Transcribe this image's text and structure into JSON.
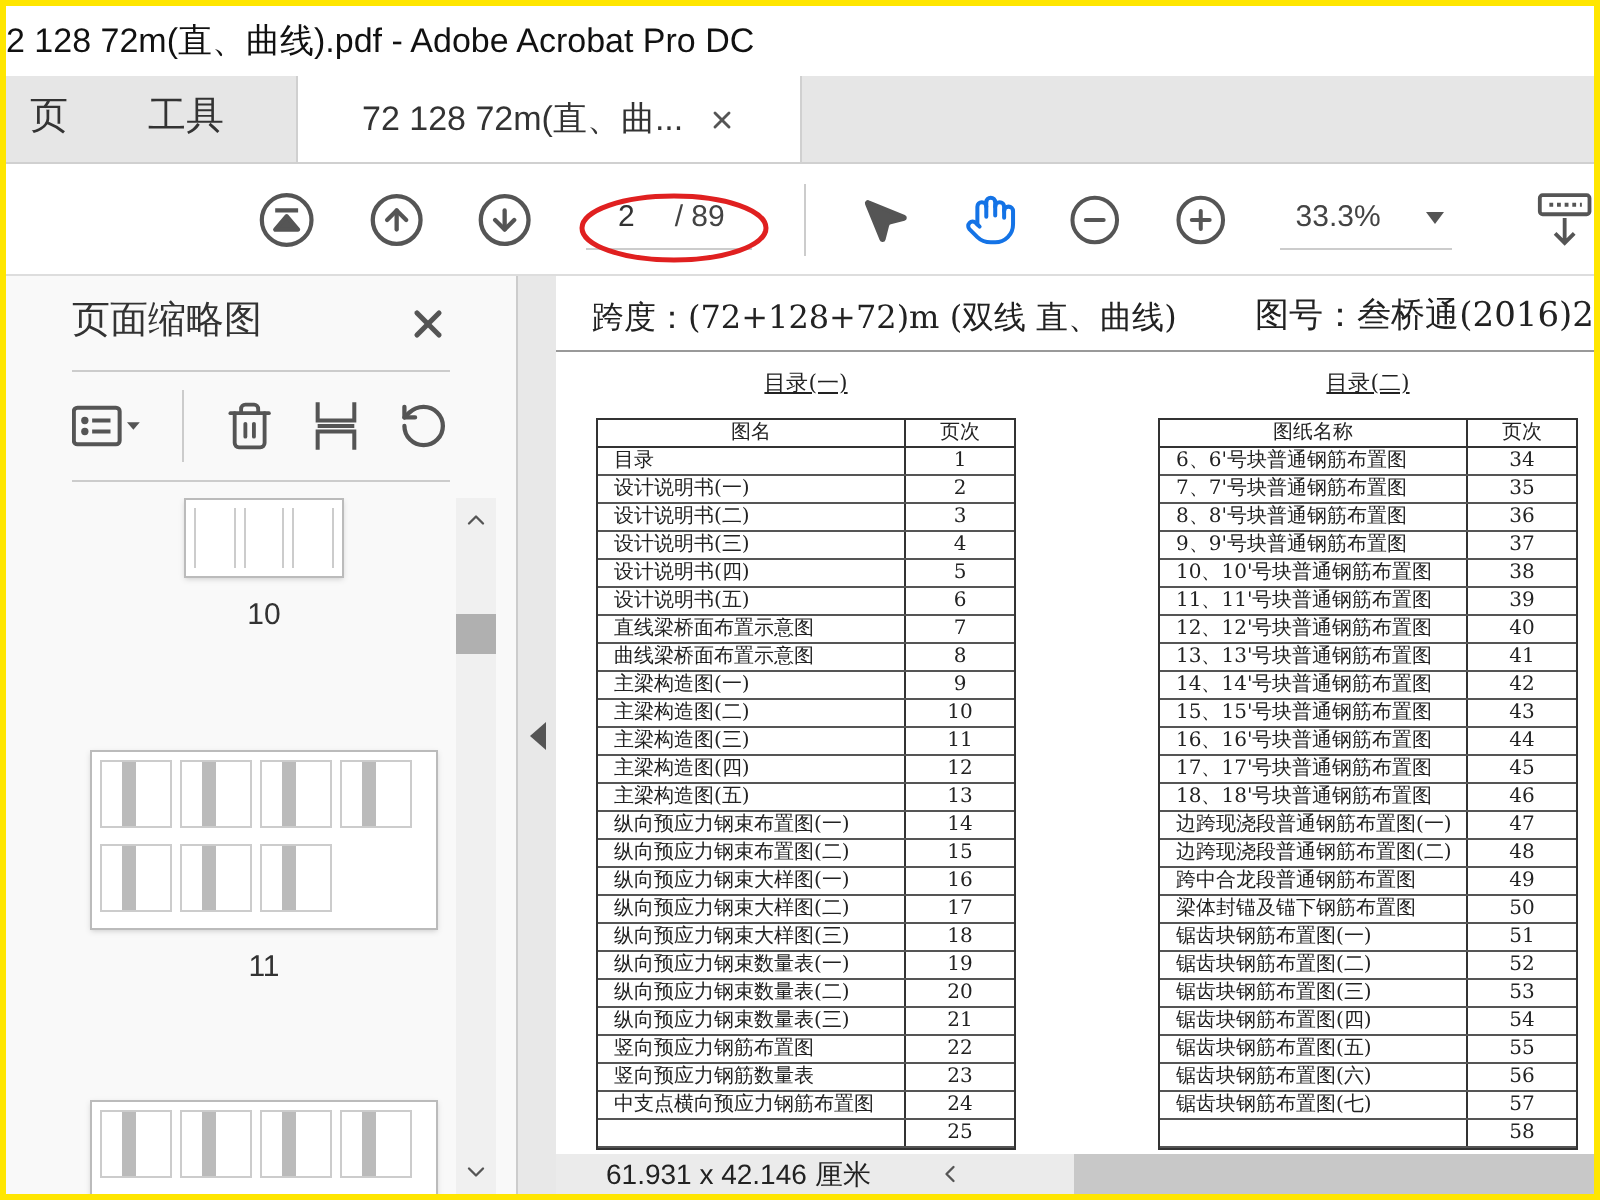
{
  "window": {
    "title": "2 128 72m(直、曲线).pdf - Adobe Acrobat Pro DC"
  },
  "tabs": [
    {
      "label": "页",
      "kind": "nav",
      "selected": false
    },
    {
      "label": "工具",
      "kind": "nav",
      "selected": false
    },
    {
      "label": "72 128 72m(直、曲...",
      "kind": "document",
      "selected": true
    }
  ],
  "toolbar": {
    "page_current": "2",
    "page_total": "/ 89",
    "zoom": "33.3%",
    "tools": [
      {
        "kind": "select",
        "selected": false
      },
      {
        "kind": "hand",
        "selected": true
      }
    ]
  },
  "sidebar": {
    "title": "页面缩略图",
    "thumbnails": [
      {
        "label": "10",
        "kind": "portrait"
      },
      {
        "label": "11",
        "kind": "landscape"
      },
      {
        "kind": "landscape"
      }
    ]
  },
  "document": {
    "header_left": "跨度：(72+128+72)m (双线 直、曲线)",
    "header_right": "图号：叁桥通(2016)2",
    "tables": [
      {
        "title": "目录(一)",
        "columns": [
          "图名",
          "页次"
        ],
        "rows": [
          {
            "name": "目录",
            "page": "1"
          },
          {
            "name": "设计说明书(一)",
            "page": "2"
          },
          {
            "name": "设计说明书(二)",
            "page": "3"
          },
          {
            "name": "设计说明书(三)",
            "page": "4"
          },
          {
            "name": "设计说明书(四)",
            "page": "5"
          },
          {
            "name": "设计说明书(五)",
            "page": "6"
          },
          {
            "name": "直线梁桥面布置示意图",
            "page": "7"
          },
          {
            "name": "曲线梁桥面布置示意图",
            "page": "8"
          },
          {
            "name": "主梁构造图(一)",
            "page": "9"
          },
          {
            "name": "主梁构造图(二)",
            "page": "10"
          },
          {
            "name": "主梁构造图(三)",
            "page": "11"
          },
          {
            "name": "主梁构造图(四)",
            "page": "12"
          },
          {
            "name": "主梁构造图(五)",
            "page": "13"
          },
          {
            "name": "纵向预应力钢束布置图(一)",
            "page": "14"
          },
          {
            "name": "纵向预应力钢束布置图(二)",
            "page": "15"
          },
          {
            "name": "纵向预应力钢束大样图(一)",
            "page": "16"
          },
          {
            "name": "纵向预应力钢束大样图(二)",
            "page": "17"
          },
          {
            "name": "纵向预应力钢束大样图(三)",
            "page": "18"
          },
          {
            "name": "纵向预应力钢束数量表(一)",
            "page": "19"
          },
          {
            "name": "纵向预应力钢束数量表(二)",
            "page": "20"
          },
          {
            "name": "纵向预应力钢束数量表(三)",
            "page": "21"
          },
          {
            "name": "竖向预应力钢筋布置图",
            "page": "22"
          },
          {
            "name": "竖向预应力钢筋数量表",
            "page": "23"
          },
          {
            "name": "中支点横向预应力钢筋布置图",
            "page": "24"
          },
          {
            "page": "25"
          }
        ]
      },
      {
        "title": "目录(二)",
        "columns": [
          "图纸名称",
          "页次"
        ],
        "rows": [
          {
            "name": "6、6'号块普通钢筋布置图",
            "page": "34"
          },
          {
            "name": "7、7'号块普通钢筋布置图",
            "page": "35"
          },
          {
            "name": "8、8'号块普通钢筋布置图",
            "page": "36"
          },
          {
            "name": "9、9'号块普通钢筋布置图",
            "page": "37"
          },
          {
            "name": "10、10'号块普通钢筋布置图",
            "page": "38"
          },
          {
            "name": "11、11'号块普通钢筋布置图",
            "page": "39"
          },
          {
            "name": "12、12'号块普通钢筋布置图",
            "page": "40"
          },
          {
            "name": "13、13'号块普通钢筋布置图",
            "page": "41"
          },
          {
            "name": "14、14'号块普通钢筋布置图",
            "page": "42"
          },
          {
            "name": "15、15'号块普通钢筋布置图",
            "page": "43"
          },
          {
            "name": "16、16'号块普通钢筋布置图",
            "page": "44"
          },
          {
            "name": "17、17'号块普通钢筋布置图",
            "page": "45"
          },
          {
            "name": "18、18'号块普通钢筋布置图",
            "page": "46"
          },
          {
            "name": "边跨现浇段普通钢筋布置图(一)",
            "page": "47"
          },
          {
            "name": "边跨现浇段普通钢筋布置图(二)",
            "page": "48"
          },
          {
            "name": "跨中合龙段普通钢筋布置图",
            "page": "49"
          },
          {
            "name": "梁体封锚及锚下钢筋布置图",
            "page": "50"
          },
          {
            "name": "锯齿块钢筋布置图(一)",
            "page": "51"
          },
          {
            "name": "锯齿块钢筋布置图(二)",
            "page": "52"
          },
          {
            "name": "锯齿块钢筋布置图(三)",
            "page": "53"
          },
          {
            "name": "锯齿块钢筋布置图(四)",
            "page": "54"
          },
          {
            "name": "锯齿块钢筋布置图(五)",
            "page": "55"
          },
          {
            "name": "锯齿块钢筋布置图(六)",
            "page": "56"
          },
          {
            "name": "锯齿块钢筋布置图(七)",
            "page": "57"
          },
          {
            "page": "58"
          }
        ]
      }
    ]
  },
  "status_bar": {
    "page_size": "61.931 x 42.146 厘米"
  }
}
